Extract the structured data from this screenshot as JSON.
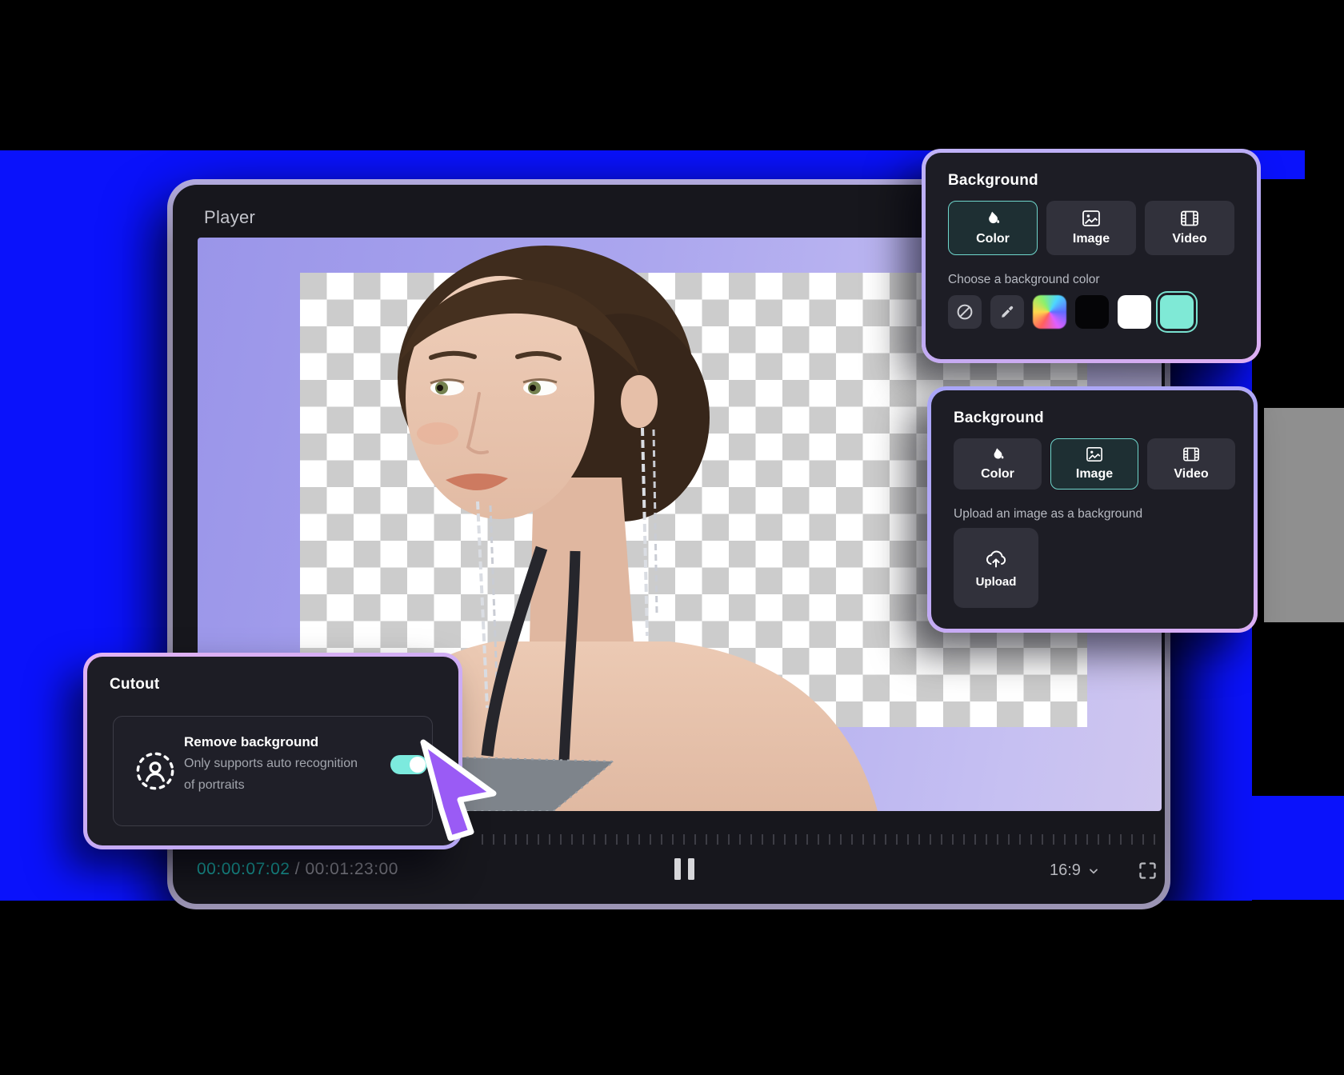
{
  "player": {
    "title": "Player",
    "current_time": "00:00:07:02",
    "time_separator": " / ",
    "total_time": "00:01:23:00",
    "aspect_ratio": "16:9",
    "controls": [
      "pause",
      "aspect-ratio-dropdown",
      "fullscreen"
    ]
  },
  "background_panel_color": {
    "title": "Background",
    "tabs": [
      {
        "label": "Color",
        "selected": true
      },
      {
        "label": "Image",
        "selected": false
      },
      {
        "label": "Video",
        "selected": false
      }
    ],
    "subtitle": "Choose a background color",
    "swatches": [
      {
        "name": "no-color",
        "type": "icon"
      },
      {
        "name": "eyedropper",
        "type": "icon"
      },
      {
        "name": "rainbow-picker",
        "type": "gradient"
      },
      {
        "name": "black",
        "hex": "#050507"
      },
      {
        "name": "white",
        "hex": "#ffffff"
      },
      {
        "name": "mint",
        "hex": "#7fe9d6",
        "selected": true
      }
    ]
  },
  "background_panel_image": {
    "title": "Background",
    "tabs": [
      {
        "label": "Color",
        "selected": false
      },
      {
        "label": "Image",
        "selected": true
      },
      {
        "label": "Video",
        "selected": false
      }
    ],
    "subtitle": "Upload an image as a background",
    "upload_label": "Upload"
  },
  "cutout_panel": {
    "title": "Cutout",
    "feature_title": "Remove background",
    "feature_desc_line1": "Only supports auto recognition",
    "feature_desc_line2": "of portraits",
    "toggle_state": "on"
  },
  "icons": {
    "color_fill": "paint-bucket-icon",
    "image": "image-icon",
    "video": "film-icon",
    "upload": "cloud-upload-icon",
    "no_color": "prohibition-icon",
    "eyedropper": "eyedropper-icon",
    "portrait_cutout": "person-dotted-circle-icon",
    "pause": "pause-icon",
    "chevron": "chevron-down-icon",
    "fullscreen": "fullscreen-icon",
    "cursor": "purple-cursor-pointer"
  },
  "colors": {
    "page_blue": "#0a12fb",
    "side_gray": "#8f8f8f",
    "accent_teal_border": "#6fd6cc",
    "toggle_teal": "#7ceade",
    "timecode_teal": "#1ba9a4",
    "cursor_purple": "#9a5bf5",
    "panel_bg": "#1d1d25"
  }
}
